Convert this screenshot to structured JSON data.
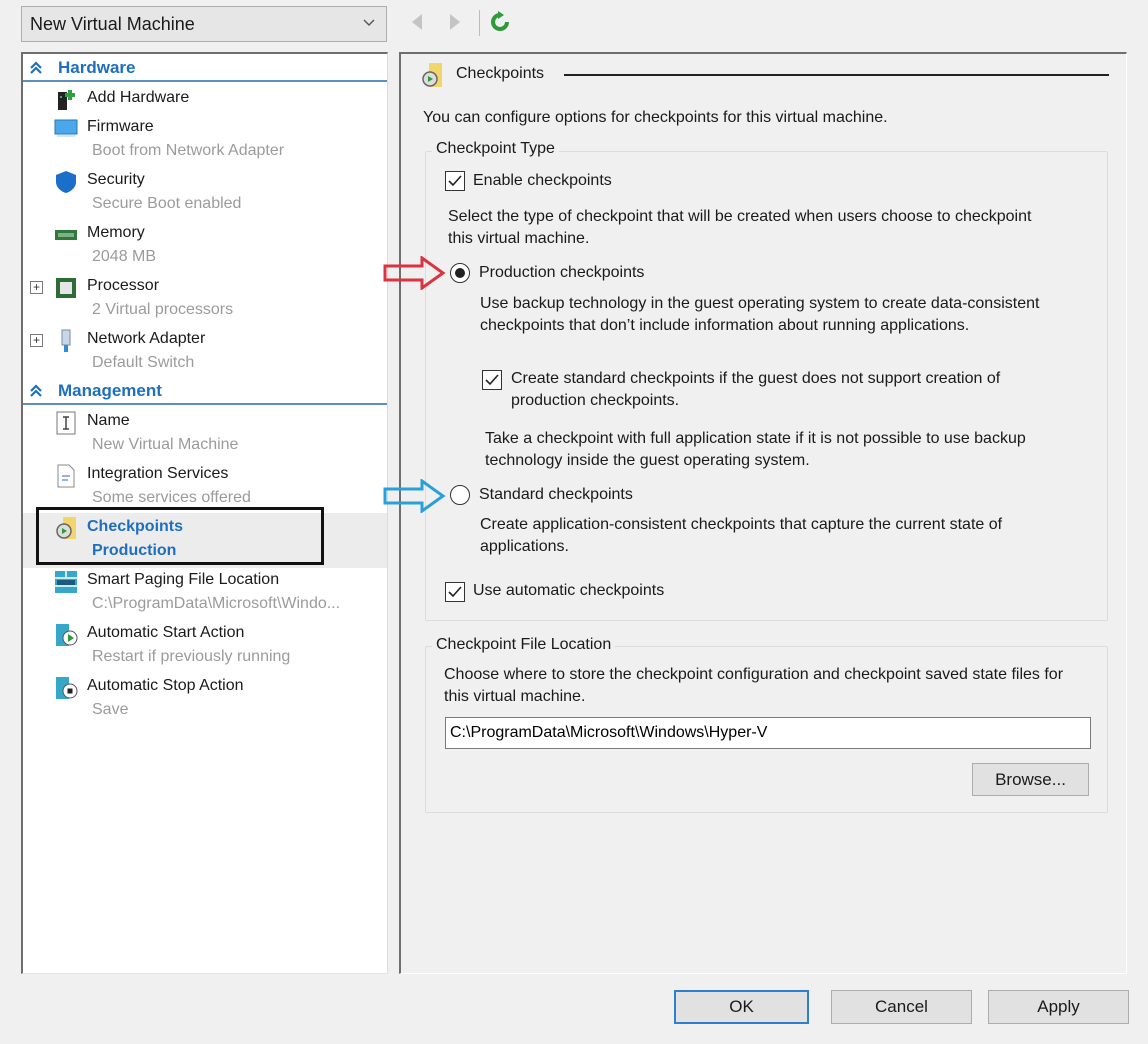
{
  "toolbar": {
    "vm_name": "New Virtual Machine",
    "icons": {
      "back": "arrow-left-icon",
      "forward": "arrow-right-icon",
      "refresh": "refresh-icon"
    }
  },
  "tree": {
    "sections": [
      {
        "label": "Hardware",
        "icon": "double-chevron-up-icon"
      },
      {
        "label": "Management",
        "icon": "double-chevron-up-icon"
      }
    ],
    "hardware": [
      {
        "label": "Add Hardware",
        "sub": "",
        "icon": "add-hardware-icon"
      },
      {
        "label": "Firmware",
        "sub": "Boot from Network Adapter",
        "icon": "firmware-icon"
      },
      {
        "label": "Security",
        "sub": "Secure Boot enabled",
        "icon": "shield-icon"
      },
      {
        "label": "Memory",
        "sub": "2048 MB",
        "icon": "memory-icon"
      },
      {
        "label": "Processor",
        "sub": "2 Virtual processors",
        "icon": "processor-icon",
        "expandable": true
      },
      {
        "label": "Network Adapter",
        "sub": "Default Switch",
        "icon": "network-adapter-icon",
        "expandable": true
      }
    ],
    "management": [
      {
        "label": "Name",
        "sub": "New Virtual Machine",
        "icon": "name-icon"
      },
      {
        "label": "Integration Services",
        "sub": "Some services offered",
        "icon": "integration-services-icon"
      },
      {
        "label": "Checkpoints",
        "sub": "Production",
        "icon": "checkpoints-icon",
        "selected": true
      },
      {
        "label": "Smart Paging File Location",
        "sub": "C:\\ProgramData\\Microsoft\\Windo...",
        "icon": "smart-paging-icon"
      },
      {
        "label": "Automatic Start Action",
        "sub": "Restart if previously running",
        "icon": "auto-start-icon"
      },
      {
        "label": "Automatic Stop Action",
        "sub": "Save",
        "icon": "auto-stop-icon"
      }
    ],
    "expand_symbol": "+"
  },
  "panel": {
    "title": "Checkpoints",
    "intro": "You can configure options for checkpoints for this virtual machine.",
    "checkpoint_type": {
      "group_label": "Checkpoint Type",
      "enable_label": "Enable checkpoints",
      "enable_checked": true,
      "select_text": "Select the type of checkpoint that will be created when users choose to checkpoint this virtual machine.",
      "production": {
        "label": "Production checkpoints",
        "selected": true,
        "description": "Use backup technology in the guest operating system to create data-consistent checkpoints that don’t include information about running applications.",
        "fallback_label": "Create standard checkpoints if the guest does not support creation of production checkpoints.",
        "fallback_checked": true,
        "fallback_note": "Take a checkpoint with full application state if it is not possible to use backup technology inside the guest operating system."
      },
      "standard": {
        "label": "Standard checkpoints",
        "selected": false,
        "description": "Create application-consistent checkpoints that capture the current state of applications."
      },
      "automatic_label": "Use automatic checkpoints",
      "automatic_checked": true
    },
    "file_location": {
      "group_label": "Checkpoint File Location",
      "description": "Choose where to store the checkpoint configuration and checkpoint saved state files for this virtual machine.",
      "path": "C:\\ProgramData\\Microsoft\\Windows\\Hyper-V",
      "browse_label": "Browse..."
    }
  },
  "annotations": {
    "red_arrow_color": "#d9343f",
    "blue_arrow_color": "#2aa0d8"
  },
  "footer": {
    "ok_label": "OK",
    "cancel_label": "Cancel",
    "apply_label": "Apply"
  },
  "colors": {
    "accent": "#1e6fbf",
    "default_button_border": "#2f7fd1"
  }
}
